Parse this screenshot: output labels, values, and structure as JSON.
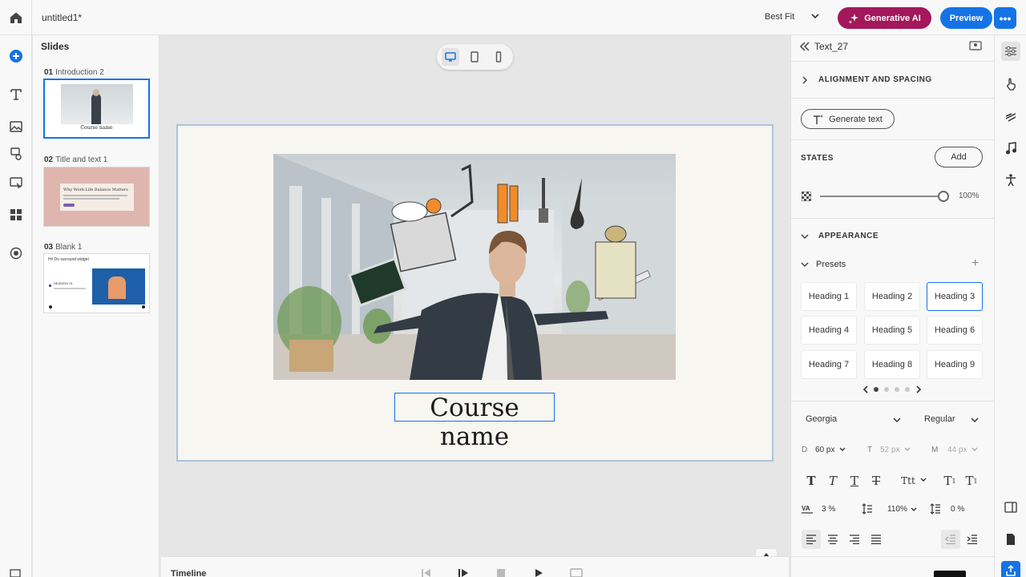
{
  "app": {
    "document_title": "untitled1*"
  },
  "toolbar": {
    "zoom": "Best Fit",
    "genai_label": "Generative AI",
    "preview_label": "Preview",
    "more_label": "•••"
  },
  "slides_panel": {
    "heading": "Slides",
    "slides": [
      {
        "number": "01",
        "name": "Introduction 2",
        "thumb_caption": "Course name"
      },
      {
        "number": "02",
        "name": "Title and text 1",
        "thumb_caption": "Why Work-Life Balance Matters"
      },
      {
        "number": "03",
        "name": "Blank 1",
        "thumb_caption": "Hi! Do surround widget",
        "thumb_sub": "HEADING 01"
      }
    ]
  },
  "canvas": {
    "course_title": "Course name"
  },
  "timeline": {
    "label": "Timeline"
  },
  "properties": {
    "element_name": "Text_27",
    "alignment_section": "ALIGNMENT AND SPACING",
    "generate_text": "Generate text",
    "states_label": "STATES",
    "states_add": "Add",
    "opacity": "100%",
    "appearance_section": "APPEARANCE",
    "presets_label": "Presets",
    "presets": [
      "Heading 1",
      "Heading 2",
      "Heading 3",
      "Heading 4",
      "Heading 5",
      "Heading 6",
      "Heading 7",
      "Heading 8",
      "Heading 9"
    ],
    "selected_preset": "Heading 3",
    "font_family": "Georgia",
    "font_weight": "Regular",
    "size_desktop_label": "D",
    "size_desktop": "60 px",
    "size_tablet_label": "T",
    "size_tablet": "52 px",
    "size_mobile_label": "M",
    "size_mobile": "44 px",
    "text_case": "Ttt",
    "letter_spacing": "3 %",
    "line_height": "110%",
    "paragraph_spacing": "0 %"
  },
  "colors": {
    "accent": "#1473e6",
    "genai": "#a3185b",
    "canvas_bg": "#f8f6f1"
  }
}
